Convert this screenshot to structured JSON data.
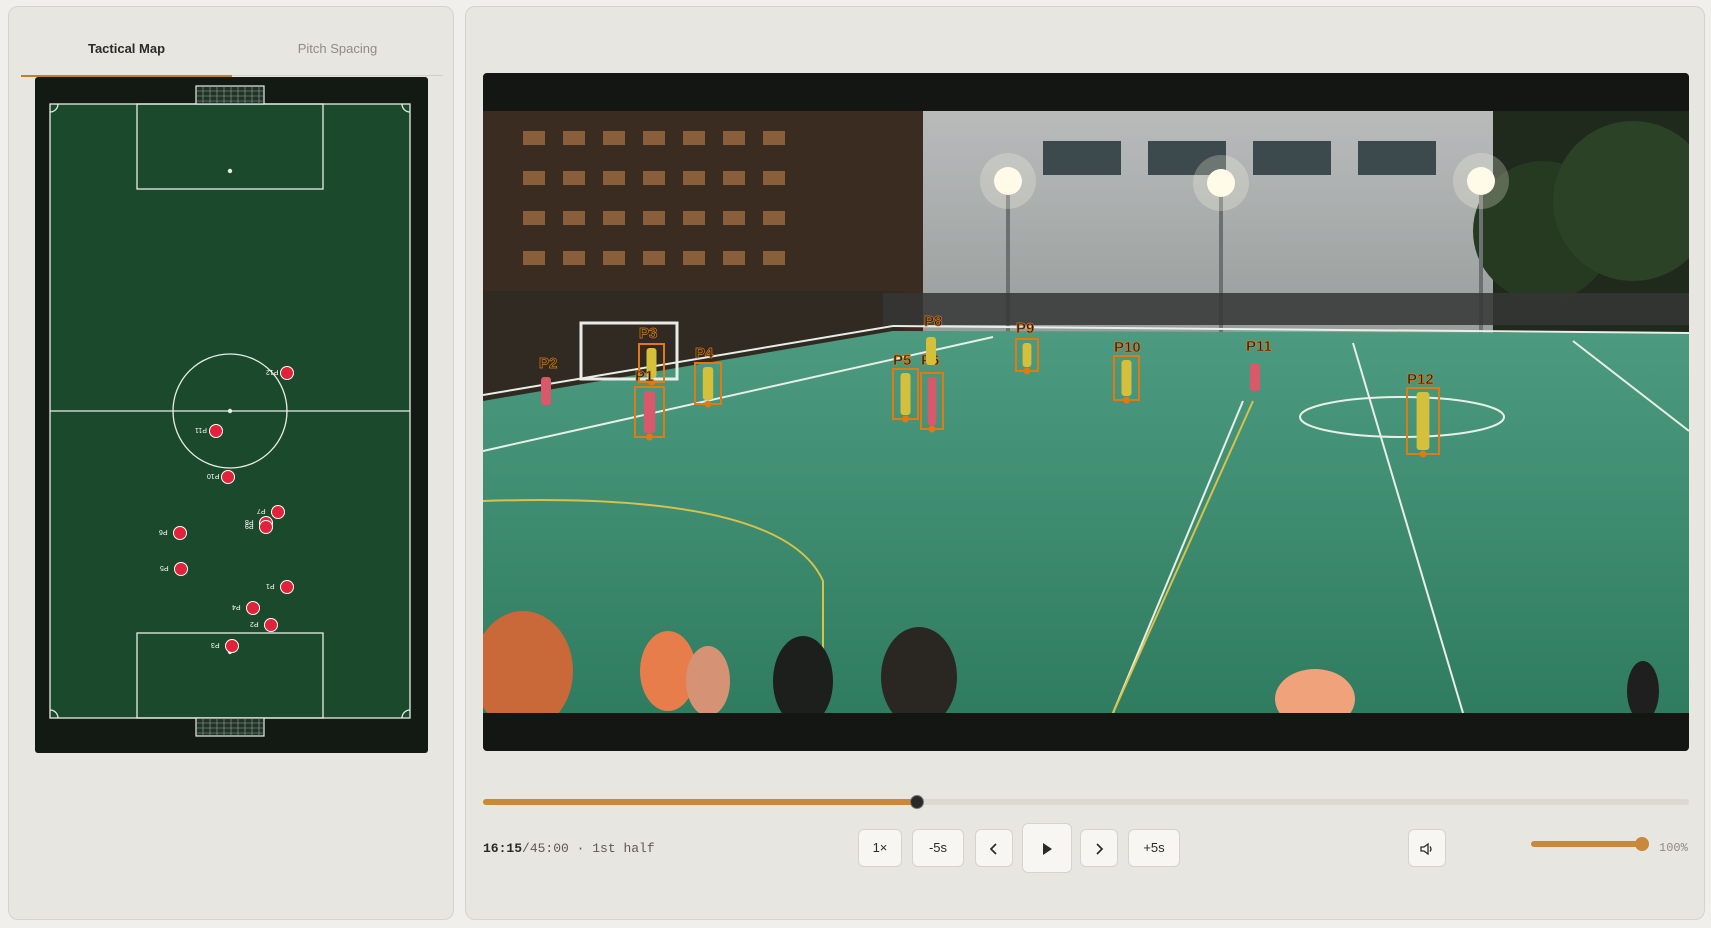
{
  "tabs": [
    {
      "label": "Tactical Map",
      "active": true
    },
    {
      "label": "Pitch Spacing",
      "active": false
    }
  ],
  "tactical_map": {
    "pitch_color": "#1a4a2b",
    "marker_color": "#e0233a",
    "players": [
      {
        "label": "P12"
      },
      {
        "label": "P11"
      },
      {
        "label": "P10"
      },
      {
        "label": "P7"
      },
      {
        "label": "P8"
      },
      {
        "label": "P9"
      },
      {
        "label": "P6"
      },
      {
        "label": "P5"
      },
      {
        "label": "P1"
      },
      {
        "label": "P4"
      },
      {
        "label": "P2"
      },
      {
        "label": "P3"
      }
    ]
  },
  "video": {
    "detections": [
      "P2",
      "P3",
      "P1",
      "P4",
      "P5",
      "P6",
      "P8",
      "P9",
      "P10",
      "P11",
      "P12"
    ]
  },
  "playback": {
    "current_time": "16:15",
    "separator": "/",
    "duration": "45:00 · 1st half",
    "progress": 0.36,
    "speed_label": "1×",
    "back5_label": "-5s",
    "prev_icon": "chevron-left-icon",
    "play_icon": "play-icon",
    "next_icon": "chevron-right-icon",
    "fwd5_label": "+5s",
    "volume_icon": "volume-icon",
    "volume_level": 1.0,
    "volume_text": "100%"
  },
  "colors": {
    "accent": "#c8893a",
    "tab_underline": "#c17f2a",
    "bbox": "#e07a12"
  }
}
